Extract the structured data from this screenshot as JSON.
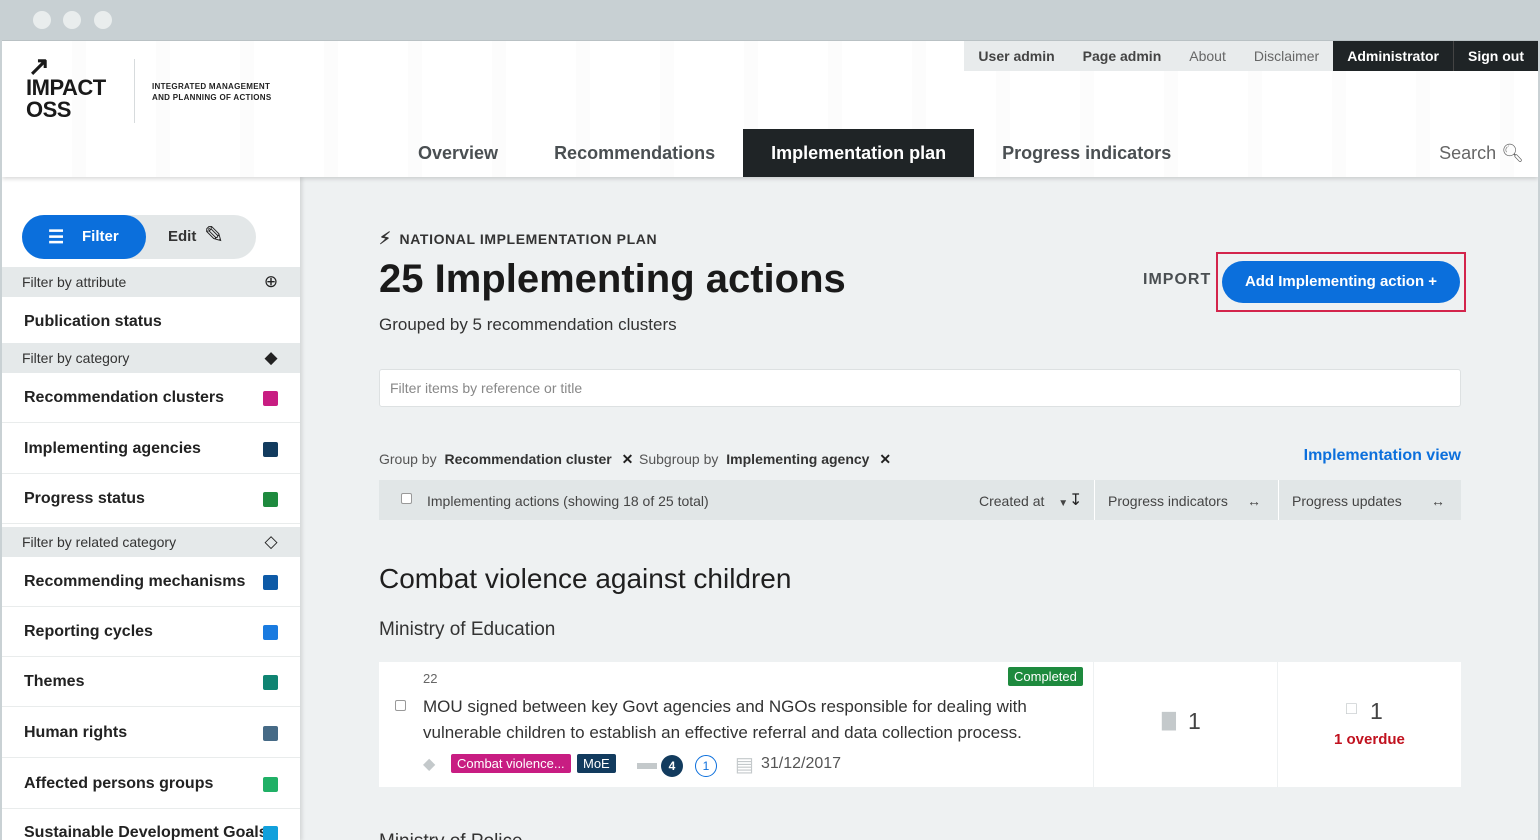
{
  "logo": {
    "text": "IMPACT OSS",
    "arrow": "↗",
    "tagline": "INTEGRATED MANAGEMENT AND PLANNING OF ACTIONS"
  },
  "topnav": [
    "User admin",
    "Page admin",
    "About",
    "Disclaimer",
    "Administrator",
    "Sign out"
  ],
  "mainnav": {
    "tabs": [
      "Overview",
      "Recommendations",
      "Implementation plan",
      "Progress indicators"
    ],
    "active": "Implementation plan",
    "search": "Search"
  },
  "sidebar": {
    "filter_label": "Filter",
    "edit_label": "Edit",
    "sections": [
      {
        "title": "Filter by attribute",
        "icon": "add-circle-icon",
        "items": [
          {
            "label": "Publication status"
          }
        ]
      },
      {
        "title": "Filter by category",
        "icon": "tag-filled-icon",
        "items": [
          {
            "label": "Recommendation clusters",
            "color": "#c81d82"
          },
          {
            "label": "Implementing agencies",
            "color": "#123b5e"
          },
          {
            "label": "Progress status",
            "color": "#1e8a3e"
          }
        ]
      },
      {
        "title": "Filter by related category",
        "icon": "tag-outline-icon",
        "items": [
          {
            "label": "Recommending mechanisms",
            "color": "#0d5aa7"
          },
          {
            "label": "Reporting cycles",
            "color": "#1a7be0"
          },
          {
            "label": "Themes",
            "color": "#0f8472"
          },
          {
            "label": "Human rights",
            "color": "#466a86"
          },
          {
            "label": "Affected persons groups",
            "color": "#20b066"
          },
          {
            "label": "Sustainable Development Goals",
            "color": "#11a0dc"
          }
        ]
      }
    ]
  },
  "main": {
    "kicker": "NATIONAL IMPLEMENTATION PLAN",
    "title": "25 Implementing actions",
    "subtitle": "Grouped by 5 recommendation clusters",
    "import_label": "IMPORT",
    "add_label": "Add Implementing action +",
    "filter_placeholder": "Filter items by reference or title",
    "group_by_label": "Group by",
    "group_by_value": "Recommendation cluster",
    "subgroup_label": "Subgroup by",
    "subgroup_value": "Implementing agency",
    "view_link": "Implementation view",
    "table": {
      "items_label": "Implementing actions (showing 18 of 25 total)",
      "created_label": "Created at",
      "col_indicators": "Progress indicators",
      "col_updates": "Progress updates"
    },
    "cluster_title": "Combat violence against children",
    "agency_title": "Ministry of Education",
    "rows": [
      {
        "ref": "22",
        "status": "Completed",
        "text": "MOU signed between key Govt agencies and NGOs responsible for dealing with vulnerable children to establish an effective referral and data collection process.",
        "tag1": "Combat violence...",
        "tag2": "MoE",
        "comments": "4",
        "count2": "1",
        "date": "31/12/2017",
        "indicators": "1",
        "updates": "1",
        "overdue": "1 overdue"
      }
    ],
    "next_agency": "Ministry of Police"
  }
}
